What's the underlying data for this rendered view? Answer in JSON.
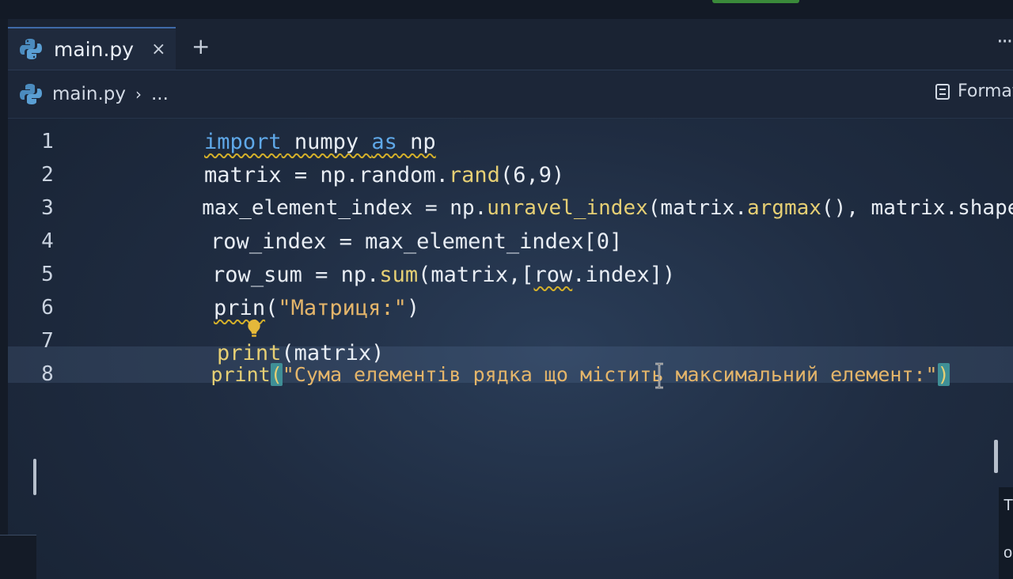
{
  "tabs": [
    {
      "label": "main.py",
      "close": "×",
      "icon": "python-icon"
    }
  ],
  "new_tab": "+",
  "more_actions": "···",
  "breadcrumb": {
    "file": "main.py",
    "separator": "›",
    "more": "..."
  },
  "toolbar": {
    "format_label": "Format"
  },
  "editor": {
    "lines": [
      {
        "number": "1"
      },
      {
        "number": "2"
      },
      {
        "number": "3"
      },
      {
        "number": "4"
      },
      {
        "number": "5"
      },
      {
        "number": "6"
      },
      {
        "number": "7"
      },
      {
        "number": "8"
      }
    ],
    "line1": {
      "t1": "import",
      "t2": " numpy ",
      "t3": "as",
      "t4": " np"
    },
    "line2": {
      "t1": "matrix = np.random.",
      "t2": "rand",
      "t3": "(6,9)"
    },
    "line3": {
      "t1": "max_element_index = np.",
      "t2": "unravel_index",
      "t3": "(matrix.",
      "t4": "argmax",
      "t5": "(), matrix.shape)"
    },
    "line4": {
      "t1": "row_index = max_element_index[",
      "t2": "0",
      "t3": "]"
    },
    "line5": {
      "t1": "row_sum = np.",
      "t2": "sum",
      "t3": "(matrix,[",
      "t4": "row",
      "t5": ".index])"
    },
    "line6": {
      "t1": "prin",
      "t2": "(",
      "t3": "\"Матриця:\"",
      "t4": ")"
    },
    "line7": {
      "t1": "print",
      "t2": "(matrix)"
    },
    "line8": {
      "t1": "print",
      "t2": "(",
      "t3": "\"Сума елементів рядка що містить максимальний елемент:\"",
      "t4": ")"
    },
    "active_line": "8"
  },
  "right_panel": {
    "char1": "T",
    "char2": "o"
  },
  "colors": {
    "keyword": "#5fa8e8",
    "function": "#e6cf74",
    "string": "#e4b56a",
    "warning_squiggle": "#d4b02a",
    "bracket_match": "#3f8f96"
  }
}
